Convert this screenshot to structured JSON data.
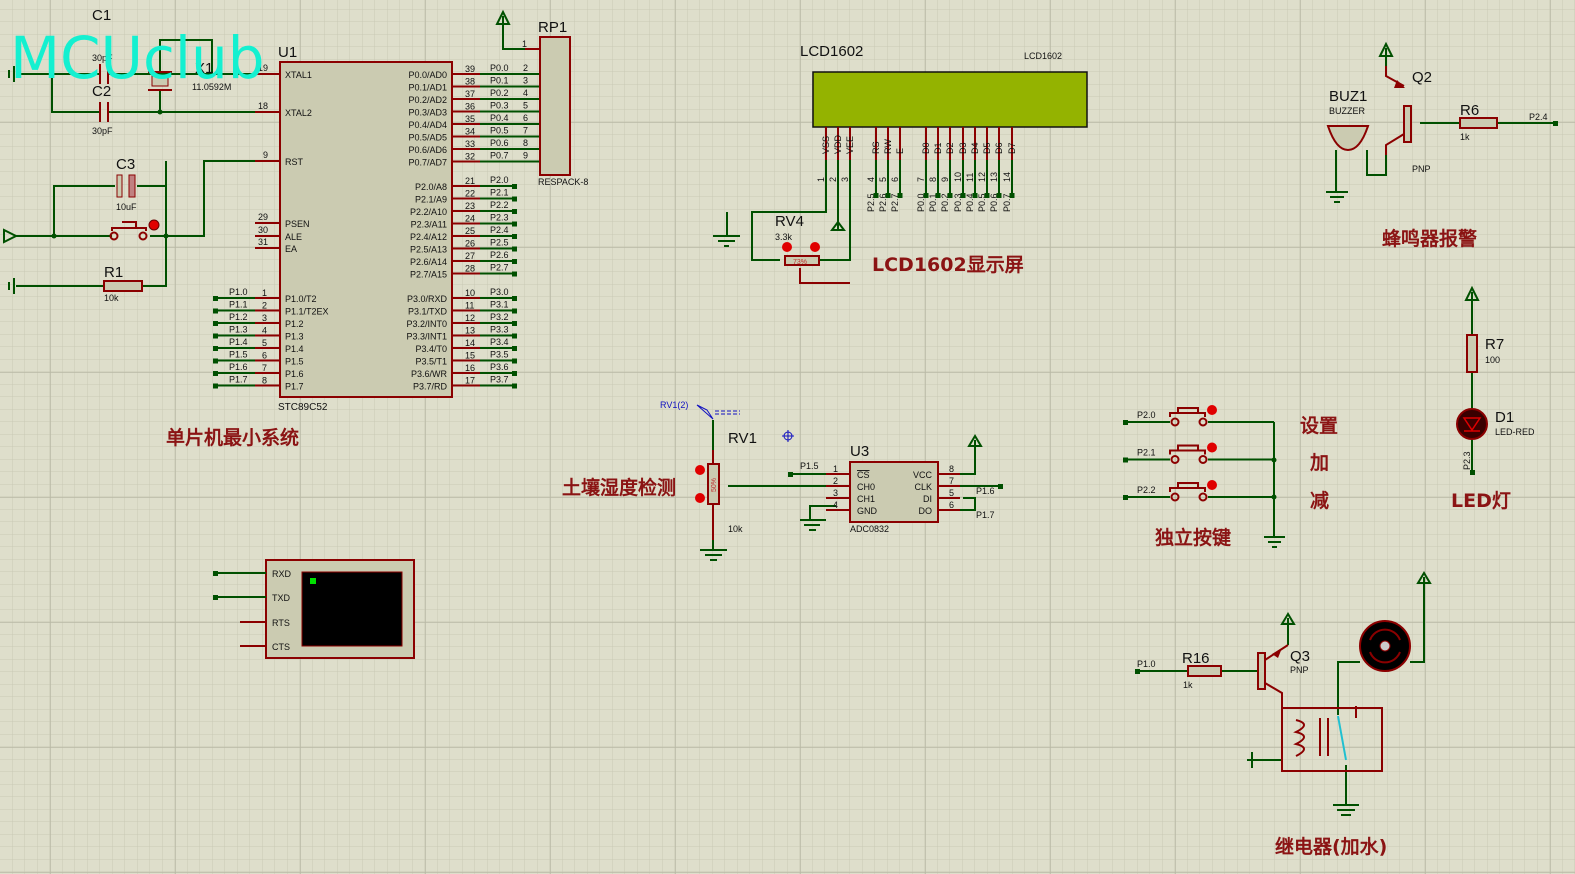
{
  "logo": "MCUclub",
  "colors": {
    "wire": "#005000",
    "pin": "#8b0000",
    "lcd_screen": "#94b300",
    "title": "#8b1414",
    "logo": "#14f0d0",
    "background": "#dedecb"
  },
  "sections": {
    "mcu": "单片机最小系统",
    "lcd": "LCD1602显示屏",
    "soil": "土壤湿度检测",
    "buzzer": "蜂鸣器报警",
    "led": "LED灯",
    "keys": "独立按键",
    "relay": "继电器(加水)",
    "key_set": "设置",
    "key_add": "加",
    "key_sub": "减"
  },
  "u1": {
    "ref": "U1",
    "part": "STC89C52",
    "left_top": [
      {
        "num": "19",
        "name": "XTAL1"
      },
      {
        "num": "18",
        "name": "XTAL2"
      },
      {
        "num": "9",
        "name": "RST"
      },
      {
        "num": "29",
        "name": "PSEN"
      },
      {
        "num": "30",
        "name": "ALE"
      },
      {
        "num": "31",
        "name": "EA"
      }
    ],
    "p1": [
      {
        "num": "1",
        "name": "P1.0/T2",
        "net": "P1.0"
      },
      {
        "num": "2",
        "name": "P1.1/T2EX",
        "net": "P1.1"
      },
      {
        "num": "3",
        "name": "P1.2",
        "net": "P1.2"
      },
      {
        "num": "4",
        "name": "P1.3",
        "net": "P1.3"
      },
      {
        "num": "5",
        "name": "P1.4",
        "net": "P1.4"
      },
      {
        "num": "6",
        "name": "P1.5",
        "net": "P1.5"
      },
      {
        "num": "7",
        "name": "P1.6",
        "net": "P1.6"
      },
      {
        "num": "8",
        "name": "P1.7",
        "net": "P1.7"
      }
    ],
    "p0": [
      {
        "num": "39",
        "name": "P0.0/AD0",
        "net": "P0.0"
      },
      {
        "num": "38",
        "name": "P0.1/AD1",
        "net": "P0.1"
      },
      {
        "num": "37",
        "name": "P0.2/AD2",
        "net": "P0.2"
      },
      {
        "num": "36",
        "name": "P0.3/AD3",
        "net": "P0.3"
      },
      {
        "num": "35",
        "name": "P0.4/AD4",
        "net": "P0.4"
      },
      {
        "num": "34",
        "name": "P0.5/AD5",
        "net": "P0.5"
      },
      {
        "num": "33",
        "name": "P0.6/AD6",
        "net": "P0.6"
      },
      {
        "num": "32",
        "name": "P0.7/AD7",
        "net": "P0.7"
      }
    ],
    "p2": [
      {
        "num": "21",
        "name": "P2.0/A8",
        "net": "P2.0"
      },
      {
        "num": "22",
        "name": "P2.1/A9",
        "net": "P2.1"
      },
      {
        "num": "23",
        "name": "P2.2/A10",
        "net": "P2.2"
      },
      {
        "num": "24",
        "name": "P2.3/A11",
        "net": "P2.3"
      },
      {
        "num": "25",
        "name": "P2.4/A12",
        "net": "P2.4"
      },
      {
        "num": "26",
        "name": "P2.5/A13",
        "net": "P2.5"
      },
      {
        "num": "27",
        "name": "P2.6/A14",
        "net": "P2.6"
      },
      {
        "num": "28",
        "name": "P2.7/A15",
        "net": "P2.7"
      }
    ],
    "p3": [
      {
        "num": "10",
        "name": "P3.0/RXD",
        "net": "P3.0"
      },
      {
        "num": "11",
        "name": "P3.1/TXD",
        "net": "P3.1"
      },
      {
        "num": "12",
        "name": "P3.2/INT0",
        "net": "P3.2"
      },
      {
        "num": "13",
        "name": "P3.3/INT1",
        "net": "P3.3"
      },
      {
        "num": "14",
        "name": "P3.4/T0",
        "net": "P3.4"
      },
      {
        "num": "15",
        "name": "P3.5/T1",
        "net": "P3.5"
      },
      {
        "num": "16",
        "name": "P3.6/WR",
        "net": "P3.6"
      },
      {
        "num": "17",
        "name": "P3.7/RD",
        "net": "P3.7"
      }
    ]
  },
  "rp1": {
    "ref": "RP1",
    "part": "RESPACK-8",
    "pins": [
      "1",
      "2",
      "3",
      "4",
      "5",
      "6",
      "7",
      "8",
      "9"
    ]
  },
  "c1": {
    "ref": "C1",
    "value": "30pF"
  },
  "c2": {
    "ref": "C2",
    "value": "30pF"
  },
  "c3": {
    "ref": "C3",
    "value": "10uF"
  },
  "x1": {
    "ref": "X1",
    "value": "11.0592M"
  },
  "r1": {
    "ref": "R1",
    "value": "10k"
  },
  "lcd": {
    "ref": "LCD1602",
    "part": "LCD1602",
    "pins": [
      {
        "name": "VSS",
        "num": "1",
        "net": ""
      },
      {
        "name": "VDD",
        "num": "2",
        "net": ""
      },
      {
        "name": "VEE",
        "num": "3",
        "net": ""
      },
      {
        "name": "RS",
        "num": "4",
        "net": "P2.5"
      },
      {
        "name": "RW",
        "num": "5",
        "net": "P2.6"
      },
      {
        "name": "E",
        "num": "6",
        "net": "P2.7"
      },
      {
        "name": "D0",
        "num": "7",
        "net": "P0.0"
      },
      {
        "name": "D1",
        "num": "8",
        "net": "P0.1"
      },
      {
        "name": "D2",
        "num": "9",
        "net": "P0.2"
      },
      {
        "name": "D3",
        "num": "10",
        "net": "P0.3"
      },
      {
        "name": "D4",
        "num": "11",
        "net": "P0.4"
      },
      {
        "name": "D5",
        "num": "12",
        "net": "P0.5"
      },
      {
        "name": "D6",
        "num": "13",
        "net": "P0.6"
      },
      {
        "name": "D7",
        "num": "14",
        "net": "P0.7"
      }
    ]
  },
  "rv4": {
    "ref": "RV4",
    "value": "3.3k",
    "position": "73%"
  },
  "rv1": {
    "ref": "RV1",
    "value": "10k",
    "position": "50%",
    "probe": "RV1(2)"
  },
  "u3": {
    "ref": "U3",
    "part": "ADC0832",
    "left": [
      {
        "num": "1",
        "name": "CS",
        "net": "P1.5"
      },
      {
        "num": "2",
        "name": "CH0"
      },
      {
        "num": "3",
        "name": "CH1"
      },
      {
        "num": "4",
        "name": "GND"
      }
    ],
    "right": [
      {
        "num": "8",
        "name": "VCC"
      },
      {
        "num": "7",
        "name": "CLK",
        "net": "P1.6"
      },
      {
        "num": "5",
        "name": "DI"
      },
      {
        "num": "6",
        "name": "DO",
        "net": "P1.7"
      }
    ]
  },
  "terminal": {
    "pins": [
      "RXD",
      "TXD",
      "RTS",
      "CTS"
    ]
  },
  "buz1": {
    "ref": "BUZ1",
    "part": "BUZZER"
  },
  "q2": {
    "ref": "Q2",
    "type": "PNP"
  },
  "r6": {
    "ref": "R6",
    "value": "1k",
    "net": "P2.4"
  },
  "r7": {
    "ref": "R7",
    "value": "100"
  },
  "d1": {
    "ref": "D1",
    "part": "LED-RED",
    "net": "P2.3"
  },
  "keys": [
    {
      "net": "P2.0"
    },
    {
      "net": "P2.1"
    },
    {
      "net": "P2.2"
    }
  ],
  "q3": {
    "ref": "Q3",
    "type": "PNP"
  },
  "r16": {
    "ref": "R16",
    "value": "1k",
    "net": "P1.0"
  }
}
